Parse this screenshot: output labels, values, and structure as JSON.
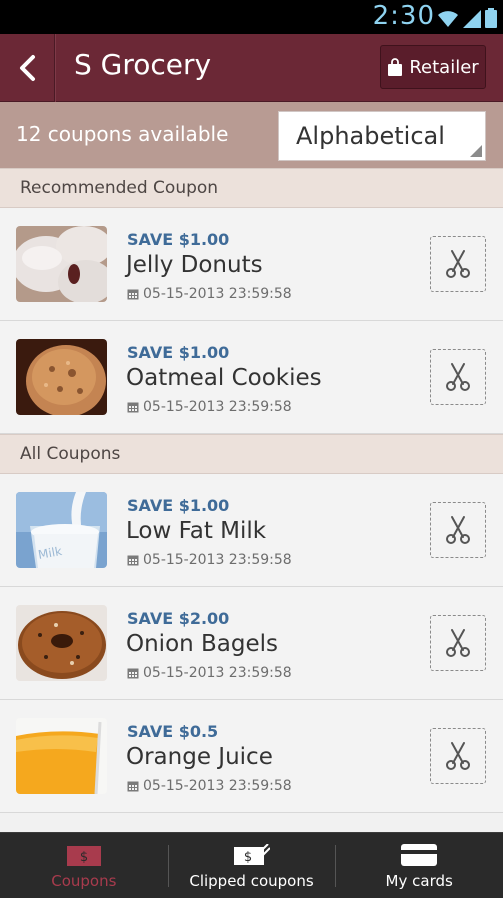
{
  "status_bar": {
    "time": "2:30"
  },
  "header": {
    "back_label": "",
    "title": "S Grocery",
    "retailer_label": "Retailer"
  },
  "sort_bar": {
    "count_text": "12 coupons available",
    "sort_value": "Alphabetical"
  },
  "sections": {
    "recommended": "Recommended Coupon",
    "all": "All Coupons"
  },
  "recommended_coupons": [
    {
      "save": "SAVE $1.00",
      "name": "Jelly Donuts",
      "date": "05-15-2013 23:59:58",
      "image": "donut"
    },
    {
      "save": "SAVE $1.00",
      "name": "Oatmeal Cookies",
      "date": "05-15-2013 23:59:58",
      "image": "cookie"
    }
  ],
  "all_coupons": [
    {
      "save": "SAVE $1.00",
      "name": "Low Fat Milk",
      "date": "05-15-2013 23:59:58",
      "image": "milk"
    },
    {
      "save": "SAVE $2.00",
      "name": "Onion Bagels",
      "date": "05-15-2013 23:59:58",
      "image": "bagel"
    },
    {
      "save": "SAVE $0.5",
      "name": "Orange Juice",
      "date": "05-15-2013 23:59:58",
      "image": "juice"
    }
  ],
  "milk_label": "Milk",
  "tabs": [
    {
      "label": "Coupons",
      "icon": "dollar-bill-icon",
      "active": true
    },
    {
      "label": "Clipped coupons",
      "icon": "clipped-coupon-icon",
      "active": false
    },
    {
      "label": "My cards",
      "icon": "card-icon",
      "active": false
    }
  ],
  "colors": {
    "header": "#6b2836",
    "accent": "#a83b4d",
    "save_text": "#3f6b98"
  }
}
